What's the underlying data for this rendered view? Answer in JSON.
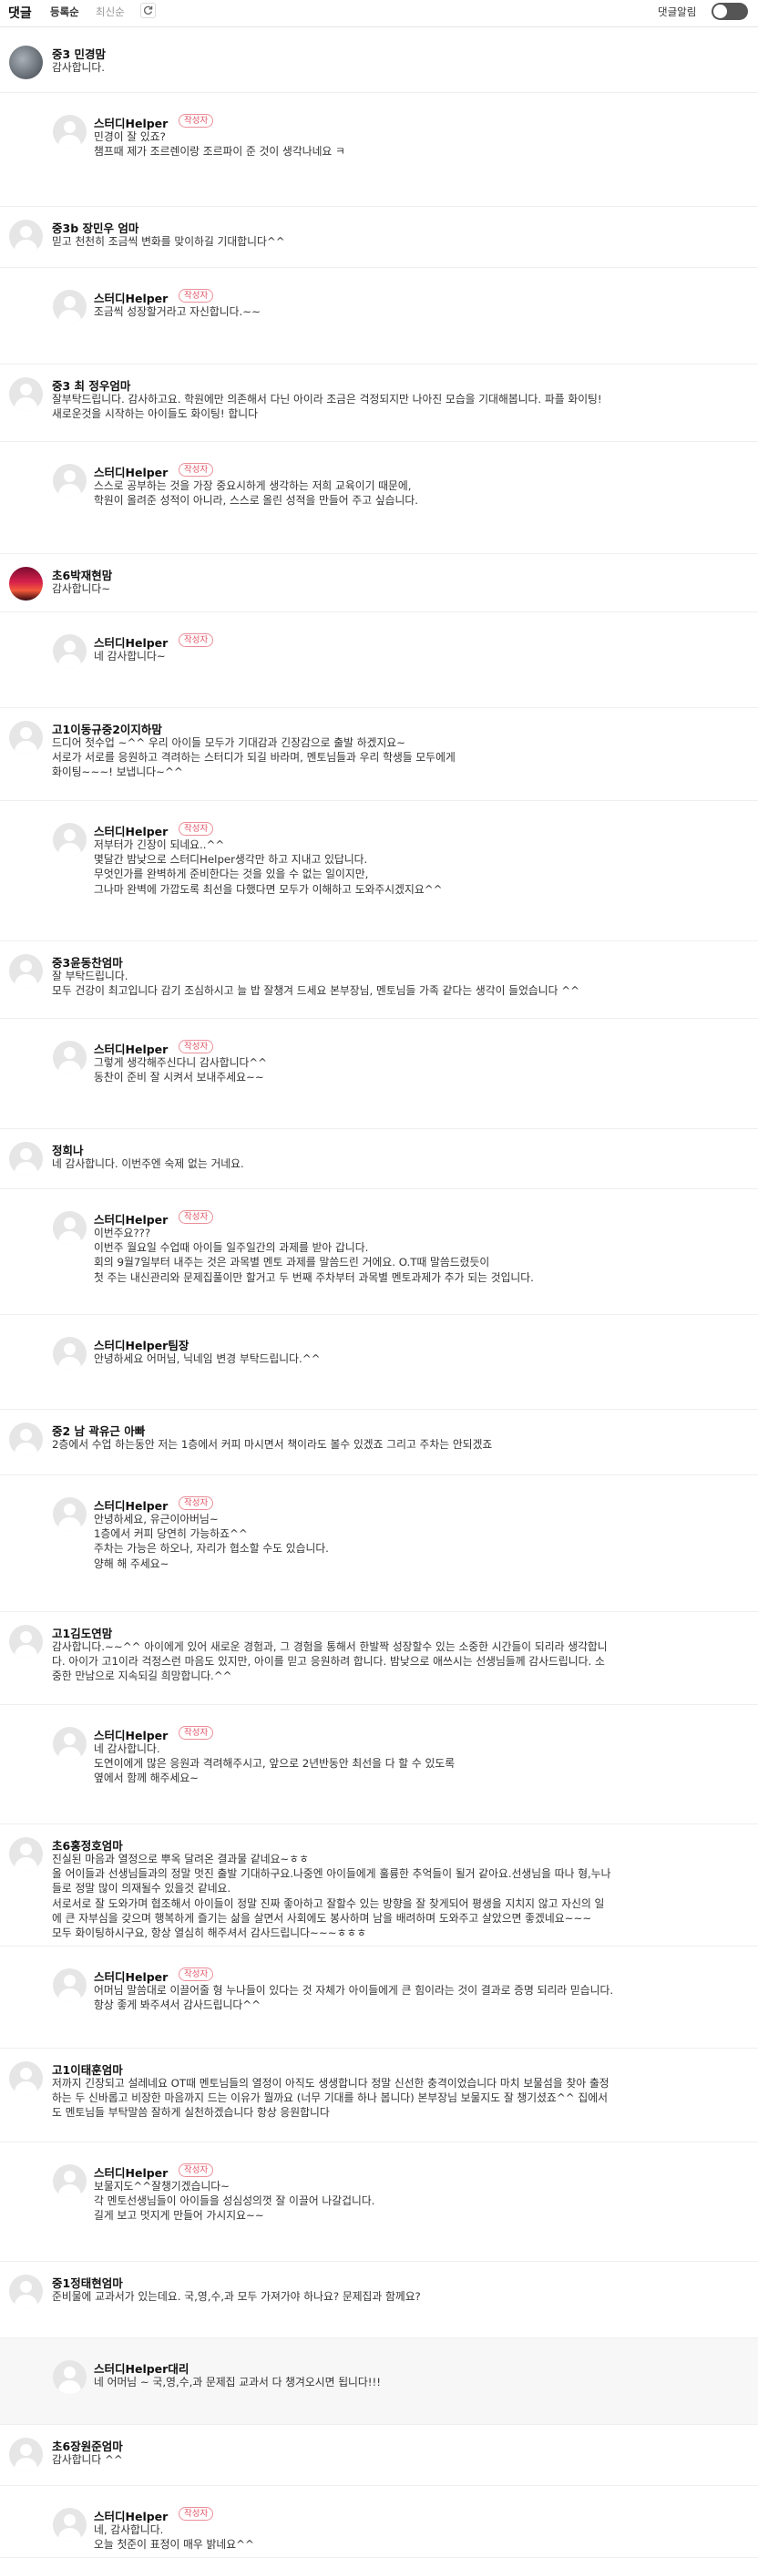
{
  "topbar": {
    "title": "댓글",
    "sort_active": "등록순",
    "sort_other": "최신순",
    "alarm_label": "댓글알림"
  },
  "comments": [
    {
      "nick": "중3 민경맘",
      "text": "감사합니다."
    },
    {
      "nick": "스터디Helper",
      "badge": "작성자",
      "text": "민경이 잘 있죠?\n챔프때 제가 조르렌이랑 조르파이 준 것이 생각나네요 ㅋ"
    },
    {
      "nick": "중3b 장민우 엄마",
      "text": "믿고 천천히 조금씩 변화를 맞이하길 기대합니다^^"
    },
    {
      "nick": "스터디Helper",
      "badge": "작성자",
      "text": "조금씩 성장할거라고 자신합니다.~~"
    },
    {
      "nick": "중3 최 정우엄마",
      "text": "잘부탁드립니다. 감사하고요. 학원에만 의존해서 다닌 아이라 조금은 걱정되지만 나아진 모습을 기대해봅니다. 파플 화이팅!\n새로운것을 시작하는 아이들도 화이팅! 합니다"
    },
    {
      "nick": "스터디Helper",
      "badge": "작성자",
      "text": "스스로 공부하는 것을 가장 중요시하게 생각하는 저희 교육이기 때문에,\n학원이 올려준 성적이 아니라, 스스로 올린 성적을 만들어 주고 싶습니다."
    },
    {
      "nick": "초6박재현맘",
      "text": "감사합니다~"
    },
    {
      "nick": "스터디Helper",
      "badge": "작성자",
      "text": "네 감사합니다~"
    },
    {
      "nick": "고1이동규중2이지하맘",
      "text": "드디어 첫수업 ~^^ 우리 아이들 모두가 기대감과 긴장감으로 출발 하겠지요~\n서로가 서로를 응원하고 격려하는 스터디가 되길 바라며, 멘토님들과 우리 학생들 모두에게\n화이팅~~~! 보냅니다~^^"
    },
    {
      "nick": "스터디Helper",
      "badge": "작성자",
      "text": "저부터가 긴장이 되네요..^^\n몇달간 밤낮으로 스터디Helper생각만 하고 지내고 있답니다.\n무엇인가를 완벽하게 준비한다는 것을 있을 수 없는 일이지만,\n그나마 완벽에 가깝도록 최선을 다했다면 모두가 이해하고 도와주시겠지요^^"
    },
    {
      "nick": "중3윤동찬엄마",
      "text": "잘 부탁드립니다.\n모두 건강이 최고입니다 감기 조심하시고 늘 밥 잘챙겨 드세요 본부장님, 멘토님들 가족 같다는 생각이 들었습니다 ^^"
    },
    {
      "nick": "스터디Helper",
      "badge": "작성자",
      "text": "그렇게 생각해주신다니 감사합니다^^\n동찬이 준비 잘 시켜서 보내주세요~~"
    },
    {
      "nick": "정희나",
      "text": "네 감사합니다. 이번주엔 숙제 없는 거네요."
    },
    {
      "nick": "스터디Helper",
      "badge": "작성자",
      "text": "이번주요???\n이번주 월요일 수업때 아이들 일주일간의 과제를 받아 갑니다.\n회의 9월7일부터 내주는 것은 과목별 멘토 과제를 말씀드린 거에요. O.T때 말씀드렸듯이\n첫 주는 내신관리와 문제집풀이만 할거고 두 번째 주차부터 과목별 멘토과제가 추가 되는 것입니다."
    },
    {
      "nick": "스터디Helper팀장",
      "text": "안녕하세요 어머님, 닉네임 변경 부탁드립니다.^^"
    },
    {
      "nick": "중2 남 곽유근 아빠",
      "text": "2층에서 수업 하는동안 저는 1층에서 커피 마시면서 책이라도 볼수 있겠죠 그리고 주차는 안되겠죠"
    },
    {
      "nick": "스터디Helper",
      "badge": "작성자",
      "text": "안녕하세요, 유근이아버님~\n1층에서 커피 당연히 가능하죠^^\n주차는 가능은 하오나, 자리가 협소할 수도 있습니다.\n양해 해 주세요~"
    },
    {
      "nick": "고1김도연맘",
      "text": "감사합니다.~~^^ 아이에게 있어 새로운 경험과, 그 경험을 통해서 한발짝 성장할수 있는 소중한 시간들이 되리라 생각합니\n다. 아이가 고1이라 걱정스런 마음도 있지만, 아이를 믿고 응원하려 합니다. 밤낮으로 애쓰시는 선생님들께 감사드립니다. 소\n중한 만남으로 지속되길 희망합니다.^^"
    },
    {
      "nick": "스터디Helper",
      "badge": "작성자",
      "text": "네 감사합니다.\n도연이에게 많은 응원과 격려해주시고, 앞으로 2년반동안 최선을 다 할 수 있도록\n옆에서 함께 해주세요~"
    },
    {
      "nick": "초6홍정호엄마",
      "text": "진실된 마음과 열정으로 뿌옥 달려온 결과물 같네요~ㅎㅎ\n올 어이들과 선생님들과의 정말 멋진 출발 기대하구요.나중엔 아이들에게 훌륭한 추억들이 될거 같아요.선생님을 따나 형,누나\n들로 정말 많이 의재될수 있을것 같네요.\n서로서로 잘 도와가며 협조해서 아이들이 정말 진짜 좋아하고 잘할수 있는 방향을 잘 찾게되어 평생을 지치지 않고 자신의 일\n에 큰 자부심을 갖으며 행복하게 즐기는 삶을 살면서 사회에도 봉사하며 남을 배려하며 도와주고 살았으면 좋겠네요~~~\n모두 화이팅하시구요, 항상 열심히 해주셔서 감사드립니다~~~ㅎㅎㅎ"
    },
    {
      "nick": "스터디Helper",
      "badge": "작성자",
      "text": "어머님 말씀대로 이끌어줄 형 누나들이 있다는 것 자체가 아이들에게 큰 힘이라는 것이 결과로 증명 되리라 믿습니다.\n항상 좋게 봐주셔서 감사드립니다^^"
    },
    {
      "nick": "고1이태훈엄마",
      "text": "저까지 긴장되고 설레네요 OT때 멘토님들의 열정이 아직도 생생합니다 정말 신선한 충격이었습니다 마치 보물섬을 찾아 출정\n하는 두 신바롭고 비장한 마음까지 드는 이유가 뭘까요 (너무 기대를 하나 봅니다) 본부장님 보물지도 잘 챙기셨죠^^ 집에서\n도 멘토님들 부탁말씀 잘하게 실천하겠습니다 항상 응원합니다"
    },
    {
      "nick": "스터디Helper",
      "badge": "작성자",
      "text": "보물지도^^잘챙기겠습니다~\n각 멘토선생님들이 아이들을 성심성의껏 잘 이끌어 나갈겁니다.\n길게 보고 멋지게 만들어 가시지요~~"
    },
    {
      "nick": "중1정태현엄마",
      "text": "준비물에 교과서가 있는데요. 국,영,수,과 모두 가져가야 하나요? 문제집과 함께요?"
    },
    {
      "nick": "스터디Helper대리",
      "text": "네 어머님 ~ 국,영,수,과 문제집 교과서 다 챙겨오시면 됩니다!!!"
    },
    {
      "nick": "초6장원준엄마",
      "text": "감사합니다 ^^"
    },
    {
      "nick": "스터디Helper",
      "badge": "작성자",
      "text": "네, 감사합니다.\n오늘 첫준이 표정이 매우 밝네요^^"
    }
  ]
}
